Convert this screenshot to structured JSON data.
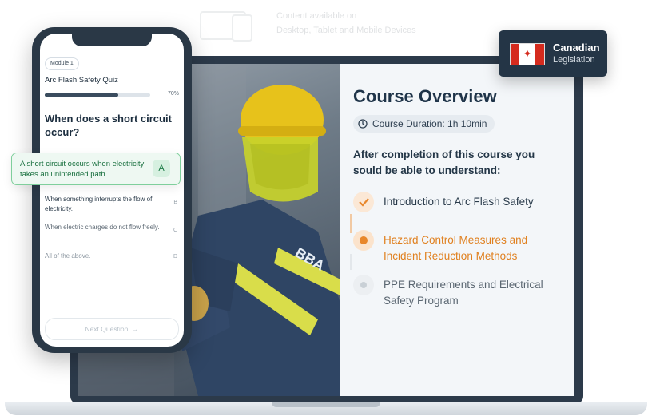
{
  "top_hint": {
    "line1": "Content available on",
    "line2": "Desktop, Tablet and Mobile Devices"
  },
  "badge": {
    "country": "Canadian",
    "sub": "Legislation",
    "flag_icon": "canada-flag-icon"
  },
  "course": {
    "title": "Course Overview",
    "duration": "Course Duration: 1h 10min",
    "intro": "After completion of this course you sould be able to understand:",
    "steps": [
      {
        "label": "Introduction to Arc Flash Safety",
        "state": "done"
      },
      {
        "label": "Hazard Control Measures and Incident Reduction Methods",
        "state": "current"
      },
      {
        "label": "PPE Requirements and Electrical Safety Program",
        "state": "upcoming"
      }
    ],
    "photo_text": "BBA"
  },
  "quiz": {
    "module": "Module 1",
    "title": "Arc Flash Safety Quiz",
    "progress_percent": 70,
    "progress_label": "70%",
    "question": "When does a short circuit occur?",
    "answers": [
      {
        "key": "A",
        "text": "A short circuit occurs when electricity takes an unintended path.",
        "selected": true
      },
      {
        "key": "B",
        "text": "When something interrupts the flow of electricity."
      },
      {
        "key": "C",
        "text": "When electric charges do not flow freely."
      },
      {
        "key": "D",
        "text": "All of the above."
      }
    ],
    "next_label": "Next Question"
  },
  "colors": {
    "accent": "#e8872b",
    "success": "#1a7a45",
    "dark": "#243546"
  }
}
